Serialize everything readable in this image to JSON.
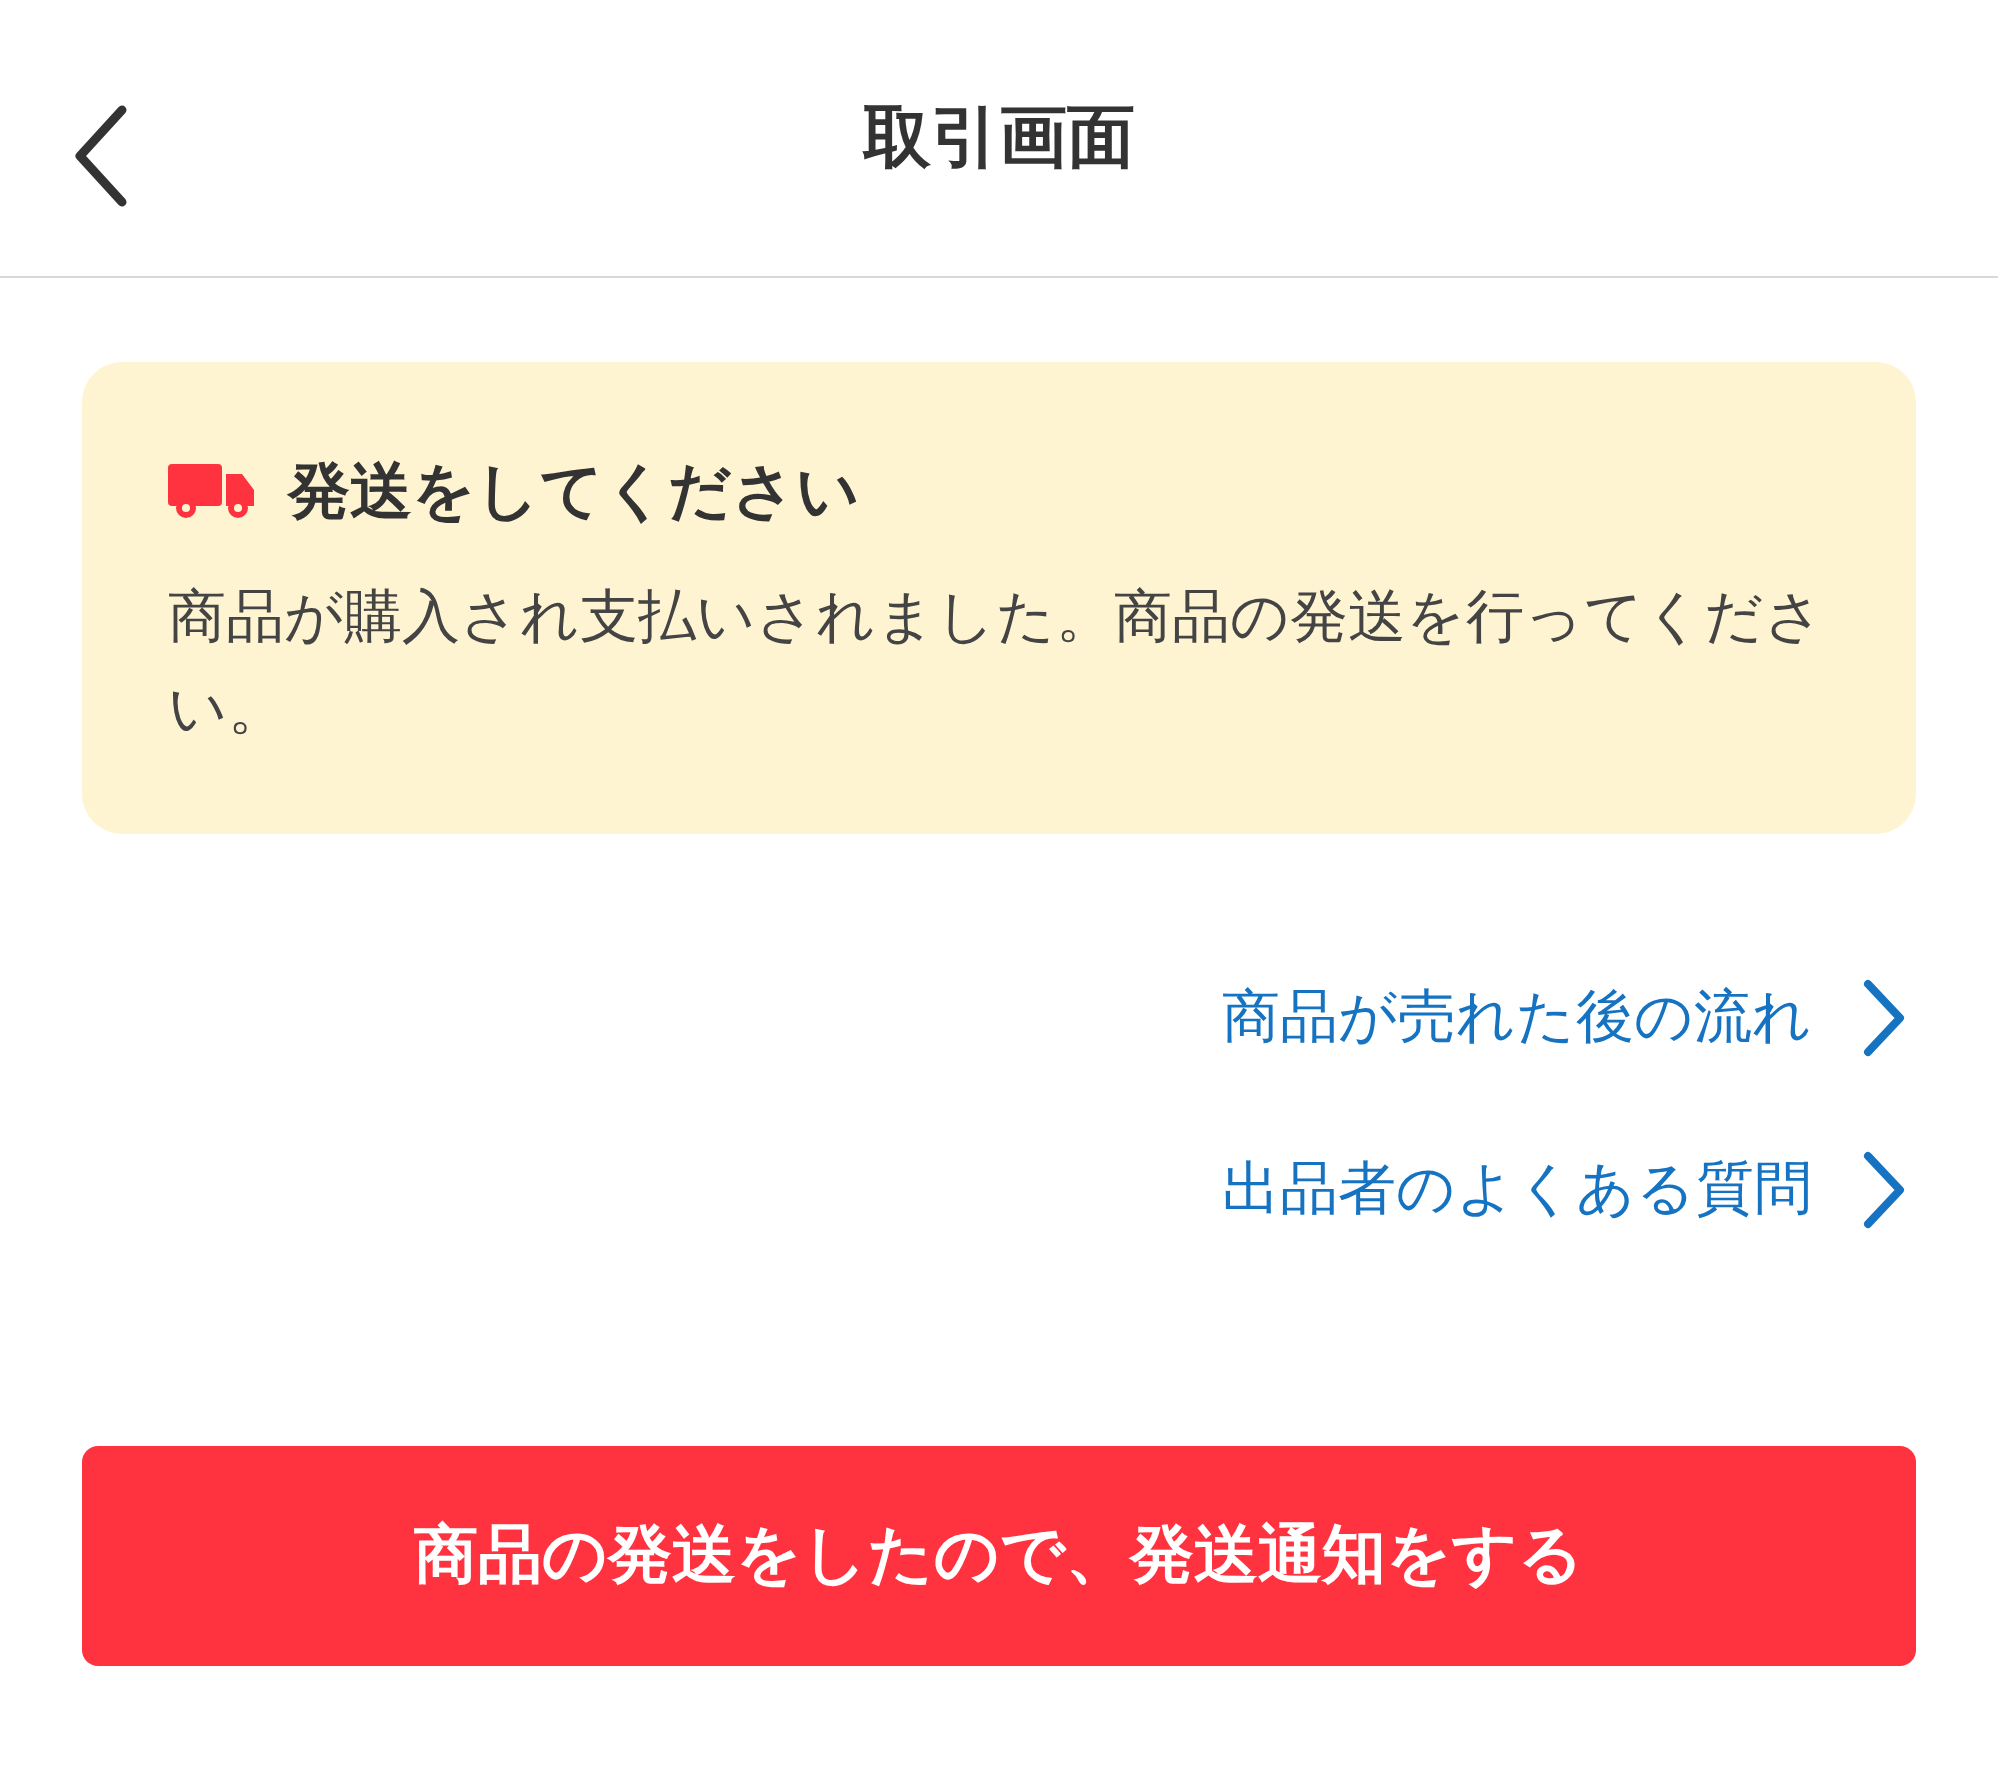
{
  "header": {
    "title": "取引画面"
  },
  "notice": {
    "title": "発送をしてください",
    "message": "商品が購入され支払いされました。商品の発送を行ってください。"
  },
  "links": [
    {
      "label": "商品が売れた後の流れ"
    },
    {
      "label": "出品者のよくある質問"
    }
  ],
  "primary_button": {
    "label": "商品の発送をしたので、発送通知をする"
  }
}
